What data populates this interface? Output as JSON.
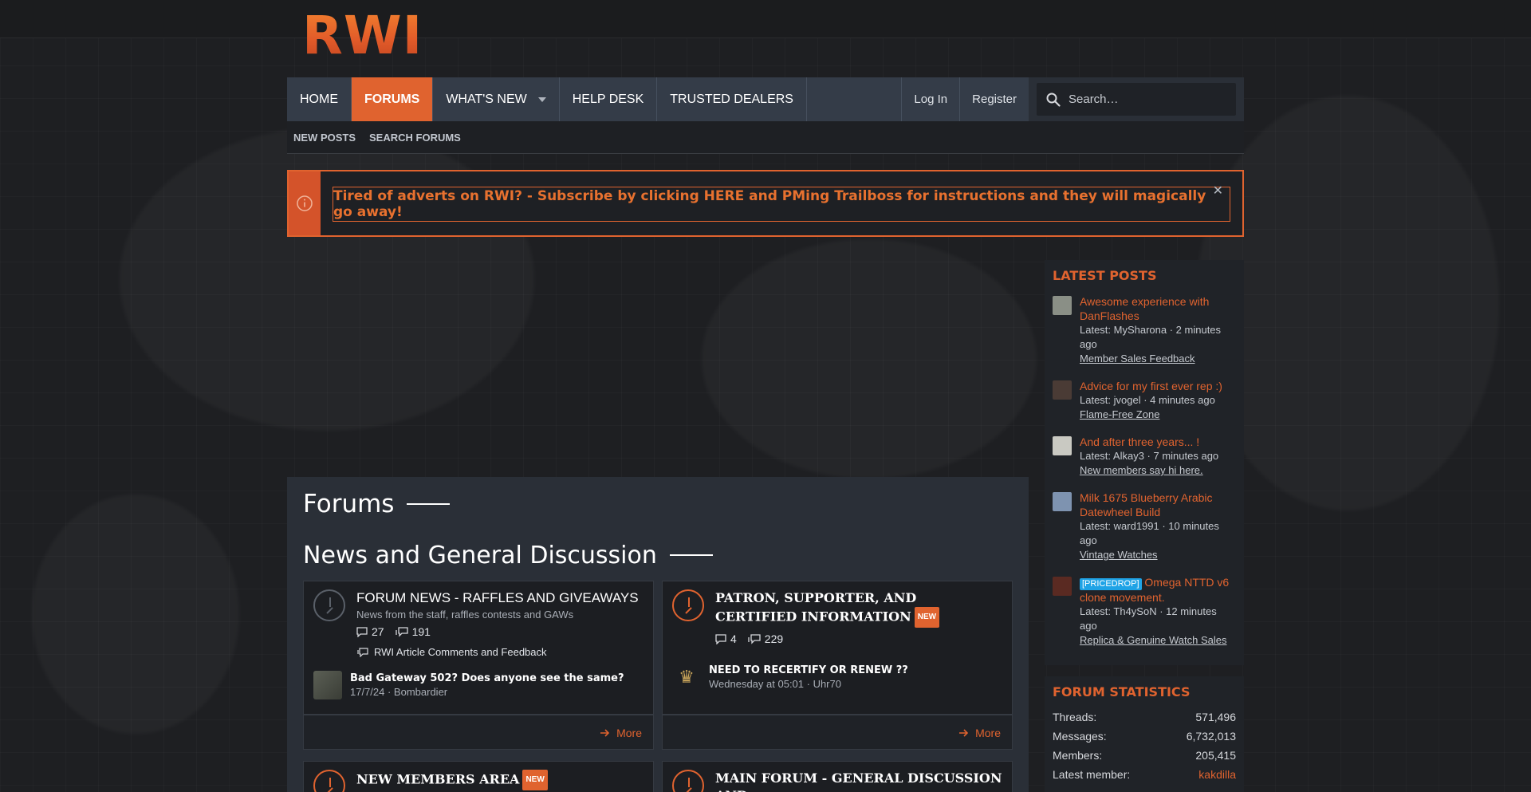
{
  "site": {
    "logo_text": "RWI"
  },
  "nav": {
    "tabs": [
      {
        "label": "HOME"
      },
      {
        "label": "FORUMS",
        "active": true
      },
      {
        "label": "WHAT'S NEW",
        "has_dropdown": true
      },
      {
        "label": "HELP DESK"
      },
      {
        "label": "TRUSTED DEALERS"
      }
    ],
    "login_label": "Log In",
    "register_label": "Register",
    "search_placeholder": "Search…"
  },
  "subnav": {
    "items": [
      "NEW POSTS",
      "SEARCH FORUMS"
    ]
  },
  "notice": {
    "text": "Tired of adverts on RWI? - Subscribe by clicking HERE and PMing Trailboss for instructions and they will magically go away!",
    "close_glyph": "✕"
  },
  "main": {
    "title": "Forums",
    "category": "News and General Discussion",
    "nodes": [
      {
        "title": "FORUM NEWS - RAFFLES AND GIVEAWAYS",
        "description": "News from the staff, raffles contests and GAWs",
        "threads": "27",
        "messages": "191",
        "sub_forum": "RWI Article Comments and Feedback",
        "last_post_title": "Bad Gateway 502? Does anyone see the same?",
        "last_post_meta": "17/7/24 · Bombardier",
        "more_label": "More",
        "is_new": false
      },
      {
        "title": "PATRON, SUPPORTER, AND CERTIFIED INFORMATION",
        "badge": "NEW",
        "threads": "4",
        "messages": "229",
        "last_post_title": "NEED TO RECERTIFY OR RENEW ??",
        "last_post_meta": "Wednesday at 05:01 · Uhr70",
        "more_label": "More",
        "is_new": true
      },
      {
        "title": "NEW MEMBERS AREA",
        "badge": "NEW",
        "is_new": true
      },
      {
        "title": "MAIN FORUM - GENERAL DISCUSSION AND",
        "is_new": true
      }
    ]
  },
  "sidebar": {
    "latest_title": "LATEST POSTS",
    "posts": [
      {
        "title": "Awesome experience with DanFlashes",
        "meta": "Latest: MySharona · 2 minutes ago",
        "forum": "Member Sales Feedback",
        "avatar_color": "#8a8f86"
      },
      {
        "title": "Advice for my first ever rep :)",
        "meta": "Latest: jvogel · 4 minutes ago",
        "forum": "Flame-Free Zone",
        "avatar_color": "#4a3b35"
      },
      {
        "title": "And after three years... !",
        "meta": "Latest: Alkay3 · 7 minutes ago",
        "forum": "New members say hi here.",
        "avatar_color": "#c9c9c2"
      },
      {
        "title": "Milk 1675 Blueberry Arabic Datewheel Build",
        "meta": "Latest: ward1991 · 10 minutes ago",
        "forum": "Vintage Watches",
        "avatar_color": "#7e93b0"
      },
      {
        "prefix": "[PRICEDROP]",
        "title": "Omega NTTD v6 clone movement.",
        "meta": "Latest: Th4ySoN · 12 minutes ago",
        "forum": "Replica & Genuine Watch Sales",
        "avatar_color": "#5a2a22"
      }
    ],
    "stats_title": "FORUM STATISTICS",
    "stats": [
      {
        "label": "Threads:",
        "value": "571,496"
      },
      {
        "label": "Messages:",
        "value": "6,732,013"
      },
      {
        "label": "Members:",
        "value": "205,415"
      },
      {
        "label": "Latest member:",
        "value": "kakdilla",
        "accent": true
      }
    ]
  },
  "colors": {
    "accent": "#e0632f",
    "nav_bg": "#343c48",
    "panel_bg": "#2a2f37",
    "prefix_blue": "#1fa3e6"
  }
}
